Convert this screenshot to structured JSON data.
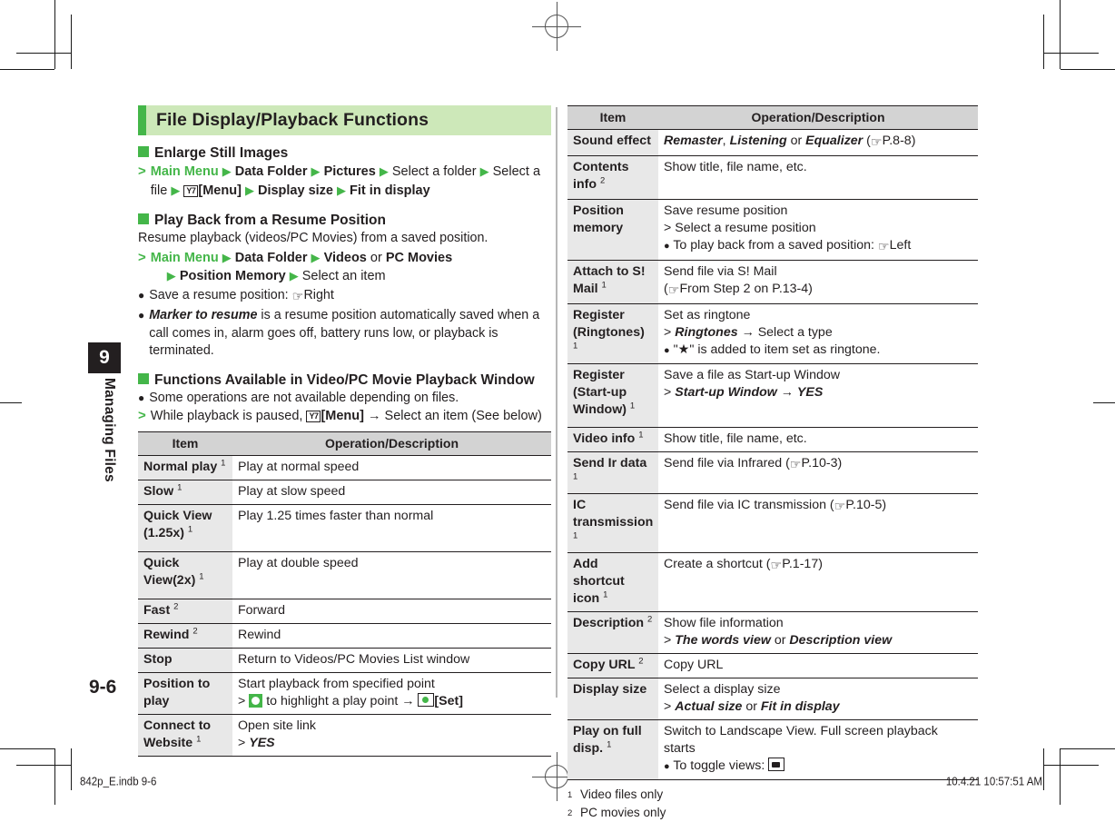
{
  "chapter": {
    "number": "9",
    "name": "Managing Files"
  },
  "page_number": "9-6",
  "section": {
    "title": "File Display/Playback Functions"
  },
  "left": {
    "heading1": "Enlarge Still Images",
    "steps1": {
      "main_menu": "Main Menu",
      "data_folder": "Data Folder",
      "pictures": "Pictures",
      "select_folder": "Select a folder",
      "select_file": "Select a file",
      "menu_key": "Y7",
      "menu_label": "[Menu]",
      "display_size": "Display size",
      "fit_in_display": "Fit in display"
    },
    "heading2": "Play Back from a Resume Position",
    "intro2": "Resume playback (videos/PC Movies) from a saved position.",
    "steps2": {
      "main_menu": "Main Menu",
      "data_folder": "Data Folder",
      "videos": "Videos",
      "or": "or",
      "pc_movies": "PC Movies",
      "position_memory": "Position Memory",
      "select_item": "Select an item"
    },
    "bullets2": [
      {
        "pre": "Save a resume position: ",
        "ref": "Right",
        "italic": ""
      },
      {
        "pre": "",
        "italic": "Marker to resume",
        "post": " is a resume position automatically saved when a call comes in, alarm goes off, battery runs low, or playback is terminated."
      }
    ],
    "heading3": "Functions Available in Video/PC Movie Playback Window",
    "bullet3": "Some operations are not available depending on files.",
    "steps3": {
      "pre": "While playback is paused, ",
      "menu_key": "Y7",
      "menu_label": "[Menu]",
      "post": " Select an item (See below)"
    },
    "table": {
      "headers": [
        "Item",
        "Operation/Description"
      ],
      "rows": [
        {
          "item": "Normal play",
          "sup": "1",
          "desc": [
            "Play at normal speed"
          ]
        },
        {
          "item": "Slow",
          "sup": "1",
          "desc": [
            "Play at slow speed"
          ]
        },
        {
          "item": "Quick View (1.25x)",
          "sup": "1",
          "desc": [
            "Play 1.25 times faster than normal"
          ],
          "tall": true
        },
        {
          "item": "Quick View(2x)",
          "sup": "1",
          "desc": [
            "Play at double speed"
          ],
          "tall": true
        },
        {
          "item": "Fast",
          "sup": "2",
          "desc": [
            "Forward"
          ]
        },
        {
          "item": "Rewind",
          "sup": "2",
          "desc": [
            "Rewind"
          ]
        },
        {
          "item": "Stop",
          "sup": "",
          "desc": [
            "Return to Videos/PC Movies List window"
          ]
        },
        {
          "item": "Position to play",
          "sup": "",
          "desc": [
            "Start playback from specified point"
          ],
          "special": "position-to-play"
        },
        {
          "item": "Connect to Website",
          "sup": "1",
          "desc": [
            "Open site link"
          ],
          "special": "connect-yes",
          "yes": "YES"
        }
      ],
      "position_play_step": {
        "mid": " to highlight a play point ",
        "set_label": "[Set]"
      }
    }
  },
  "right": {
    "table": {
      "headers": [
        "Item",
        "Operation/Description"
      ],
      "rows": [
        {
          "item": "Sound effect",
          "sup": "",
          "lines": [
            {
              "type": "mixed-sound",
              "a": "Remaster",
              "comma": ", ",
              "b": "Listening",
              "or": " or ",
              "c": "Equalizer",
              "ref": "P.8-8"
            }
          ]
        },
        {
          "item": "Contents info",
          "sup": "2",
          "tall": true,
          "lines": [
            {
              "type": "plain",
              "text": "Show title, file name, etc."
            }
          ]
        },
        {
          "item": "Position memory",
          "sup": "",
          "lines": [
            {
              "type": "plain",
              "text": "Save resume position"
            },
            {
              "type": "step",
              "text": "Select a resume position"
            },
            {
              "type": "bullet-ref",
              "pre": "To play back from a saved position: ",
              "ref": "Left"
            }
          ]
        },
        {
          "item": "Attach to S! Mail",
          "sup": "1",
          "lines": [
            {
              "type": "plain",
              "text": "Send file via S! Mail"
            },
            {
              "type": "ref-paren",
              "pre": "From Step 2 on P.13-4"
            }
          ]
        },
        {
          "item": "Register (Ringtones)",
          "sup": "1",
          "lines": [
            {
              "type": "plain",
              "text": "Set as ringtone"
            },
            {
              "type": "step-italic",
              "italic": "Ringtones",
              "post": " Select a type"
            },
            {
              "type": "bullet-star",
              "text": "\" \" is added to item set as ringtone."
            }
          ]
        },
        {
          "item": "Register (Start-up Window)",
          "sup": "1",
          "tall": true,
          "lines": [
            {
              "type": "plain",
              "text": "Save a file as Start-up Window"
            },
            {
              "type": "step-italic2",
              "italic": "Start-up Window",
              "italic2": "YES"
            }
          ]
        },
        {
          "item": "Video info",
          "sup": "1",
          "lines": [
            {
              "type": "plain",
              "text": "Show title, file name, etc."
            }
          ]
        },
        {
          "item": "Send Ir data",
          "sup": "1",
          "lines": [
            {
              "type": "plain-ref",
              "text": "Send file via Infrared (",
              "ref": "P.10-3"
            }
          ]
        },
        {
          "item": "IC transmission",
          "sup": "1",
          "tall": true,
          "lines": [
            {
              "type": "plain-ref",
              "text": "Send file via IC transmission (",
              "ref": "P.10-5"
            }
          ]
        },
        {
          "item": "Add shortcut icon",
          "sup": "1",
          "tall": true,
          "lines": [
            {
              "type": "plain-ref",
              "text": "Create a shortcut (",
              "ref": "P.1-17"
            }
          ]
        },
        {
          "item": "Description",
          "sup": "2",
          "lines": [
            {
              "type": "plain",
              "text": "Show file information"
            },
            {
              "type": "step-italic-or",
              "italic": "The words view",
              "or": " or ",
              "italic2": "Description view"
            }
          ]
        },
        {
          "item": "Copy URL",
          "sup": "2",
          "lines": [
            {
              "type": "plain",
              "text": "Copy URL"
            }
          ]
        },
        {
          "item": "Display size",
          "sup": "",
          "lines": [
            {
              "type": "plain",
              "text": "Select a display size"
            },
            {
              "type": "step-italic-or",
              "italic": "Actual size",
              "or": " or ",
              "italic2": "Fit in display"
            }
          ]
        },
        {
          "item": "Play on full disp.",
          "sup": "1",
          "lines": [
            {
              "type": "plain",
              "text": "Switch to Landscape View. Full screen playback starts"
            },
            {
              "type": "bullet-cam",
              "text": "To toggle views: "
            }
          ]
        }
      ]
    },
    "footnotes": [
      {
        "n": "1",
        "text": "Video files only"
      },
      {
        "n": "2",
        "text": "PC movies only"
      }
    ]
  },
  "print_footer": {
    "left": "842p_E.indb   9-6",
    "right": "10.4.21   10:57:51 AM"
  },
  "colors": {
    "accent_green": "#44b649",
    "title_bg": "#cde8b9",
    "table_header_bg": "#d3d3d3",
    "item_bg": "#e8e8e8",
    "text": "#231f20"
  }
}
